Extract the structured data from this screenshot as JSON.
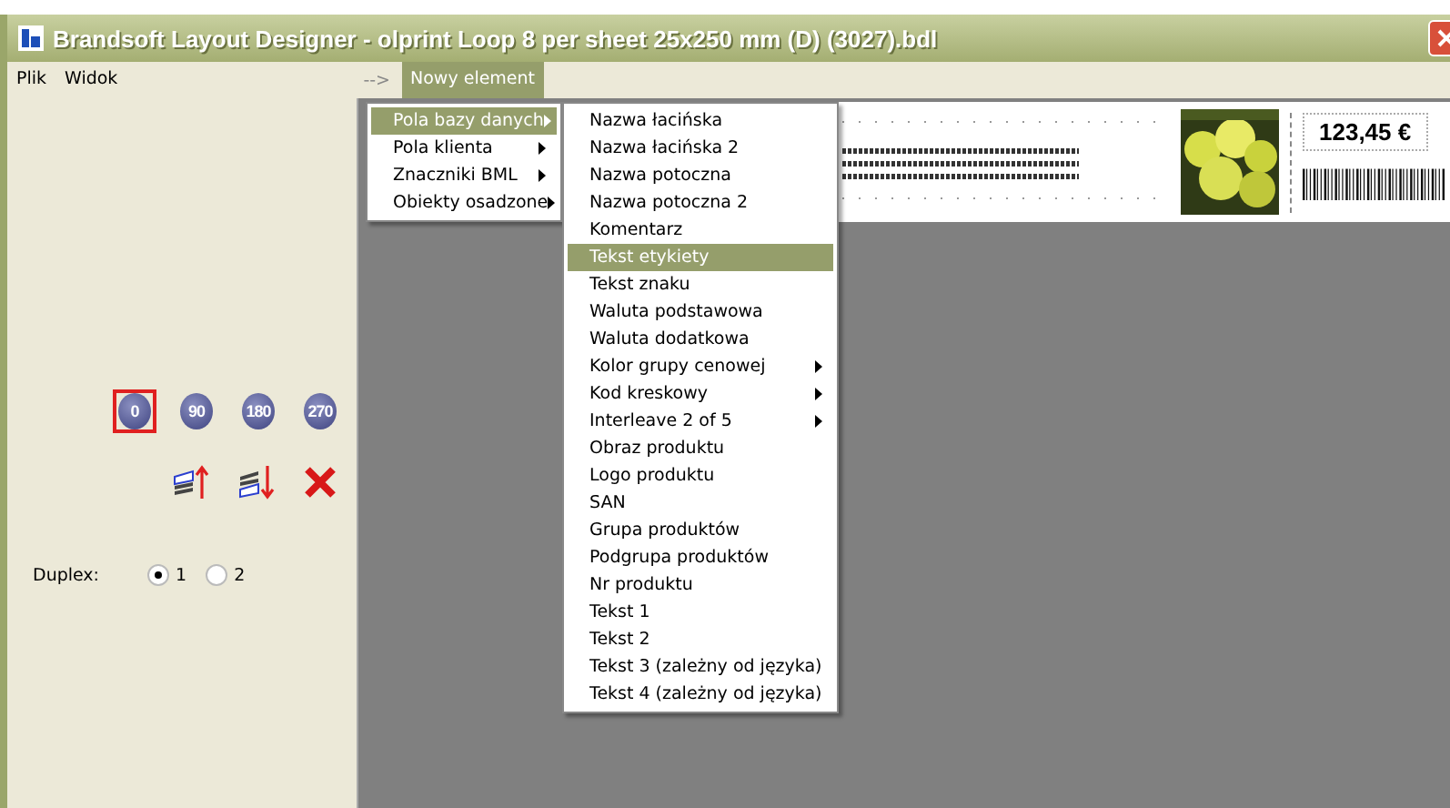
{
  "window": {
    "title": "Brandsoft Layout Designer   -   olprint Loop 8 per sheet 25x250 mm (D) (3027).bdl"
  },
  "menu_bar": {
    "items": [
      {
        "label": "Plik",
        "selected": false
      },
      {
        "label": "Widok",
        "selected": false
      }
    ],
    "arrow": "-->",
    "new_element": {
      "label": "Nowy element",
      "selected": true
    }
  },
  "menu": {
    "items": [
      {
        "label": "Pola bazy danych",
        "selected": true,
        "submenu": true
      },
      {
        "label": "Pola klienta",
        "selected": false,
        "submenu": true
      },
      {
        "label": "Znaczniki BML",
        "selected": false,
        "submenu": true
      },
      {
        "label": "Obiekty osadzone",
        "selected": false,
        "submenu": true
      }
    ]
  },
  "submenu": {
    "items": [
      {
        "label": "Nazwa łacińska",
        "selected": false,
        "submenu": false
      },
      {
        "label": "Nazwa łacińska 2",
        "selected": false,
        "submenu": false
      },
      {
        "label": "Nazwa potoczna",
        "selected": false,
        "submenu": false
      },
      {
        "label": "Nazwa potoczna 2",
        "selected": false,
        "submenu": false
      },
      {
        "label": "Komentarz",
        "selected": false,
        "submenu": false
      },
      {
        "label": "Tekst etykiety",
        "selected": true,
        "submenu": false
      },
      {
        "label": "Tekst znaku",
        "selected": false,
        "submenu": false
      },
      {
        "label": "Waluta podstawowa",
        "selected": false,
        "submenu": false
      },
      {
        "label": "Waluta dodatkowa",
        "selected": false,
        "submenu": false
      },
      {
        "label": "Kolor grupy cenowej",
        "selected": false,
        "submenu": true
      },
      {
        "label": "Kod kreskowy",
        "selected": false,
        "submenu": true
      },
      {
        "label": "Interleave 2 of 5",
        "selected": false,
        "submenu": true
      },
      {
        "label": "Obraz produktu",
        "selected": false,
        "submenu": false
      },
      {
        "label": "Logo produktu",
        "selected": false,
        "submenu": false
      },
      {
        "label": "SAN",
        "selected": false,
        "submenu": false
      },
      {
        "label": "Grupa produktów",
        "selected": false,
        "submenu": false
      },
      {
        "label": "Podgrupa produktów",
        "selected": false,
        "submenu": false
      },
      {
        "label": "Nr produktu",
        "selected": false,
        "submenu": false
      },
      {
        "label": "Tekst 1",
        "selected": false,
        "submenu": false
      },
      {
        "label": "Tekst 2",
        "selected": false,
        "submenu": false
      },
      {
        "label": "Tekst 3 (zależny od języka)",
        "selected": false,
        "submenu": false
      },
      {
        "label": "Tekst 4 (zależny od języka)",
        "selected": false,
        "submenu": false
      }
    ]
  },
  "rotation": [
    {
      "label": "0",
      "selected": true
    },
    {
      "label": "90",
      "selected": false
    },
    {
      "label": "180",
      "selected": false
    },
    {
      "label": "270",
      "selected": false
    }
  ],
  "duplex": {
    "label": "Duplex:",
    "options": [
      {
        "label": "1",
        "selected": true
      },
      {
        "label": "2",
        "selected": false
      }
    ]
  },
  "label_preview": {
    "price": "123,45 €"
  }
}
